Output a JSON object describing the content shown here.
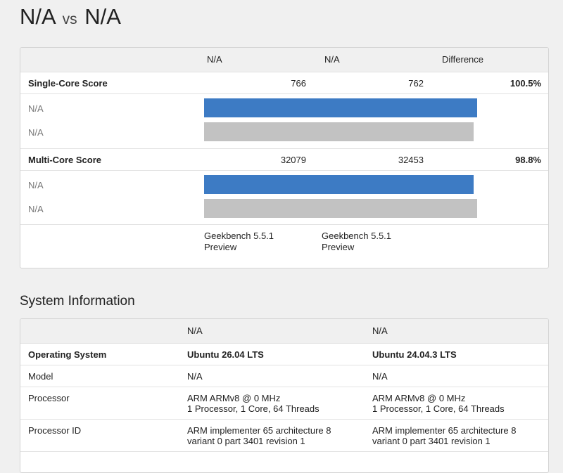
{
  "page": {
    "title_left": "N/A",
    "title_vs": "vs",
    "title_right": "N/A"
  },
  "score_table": {
    "headers": {
      "left": "N/A",
      "right": "N/A",
      "difference": "Difference"
    },
    "single_core": {
      "label": "Single-Core Score",
      "left_value": "766",
      "right_value": "762",
      "difference": "100.5%",
      "bars": [
        {
          "label": "N/A",
          "fraction": 1.0,
          "color": "#3d7bc4"
        },
        {
          "label": "N/A",
          "fraction": 0.9878,
          "color": "#c2c2c2"
        }
      ]
    },
    "multi_core": {
      "label": "Multi-Core Score",
      "left_value": "32079",
      "right_value": "32453",
      "difference": "98.8%",
      "bars": [
        {
          "label": "N/A",
          "fraction": 0.9881,
          "color": "#3d7bc4"
        },
        {
          "label": "N/A",
          "fraction": 1.0,
          "color": "#c2c2c2"
        }
      ]
    },
    "versions": {
      "left_line1": "Geekbench 5.5.1",
      "left_line2": "Preview",
      "right_line1": "Geekbench 5.5.1",
      "right_line2": "Preview"
    }
  },
  "system_info": {
    "title": "System Information",
    "headers": {
      "left": "N/A",
      "right": "N/A"
    },
    "rows": [
      {
        "label": "Operating System",
        "left": "Ubuntu 26.04 LTS",
        "right": "Ubuntu 24.04.3 LTS"
      },
      {
        "label": "Model",
        "left": "N/A",
        "right": "N/A"
      },
      {
        "label": "Processor",
        "left_line1": "ARM ARMv8 @ 0 MHz",
        "left_line2": "1 Processor, 1 Core, 64 Threads",
        "right_line1": "ARM ARMv8 @ 0 MHz",
        "right_line2": "1 Processor, 1 Core, 64 Threads"
      },
      {
        "label": "Processor ID",
        "left_line1": "ARM implementer 65 architecture 8",
        "left_line2": "variant 0 part 3401 revision 1",
        "right_line1": "ARM implementer 65 architecture 8",
        "right_line2": "variant 0 part 3401 revision 1"
      }
    ]
  }
}
